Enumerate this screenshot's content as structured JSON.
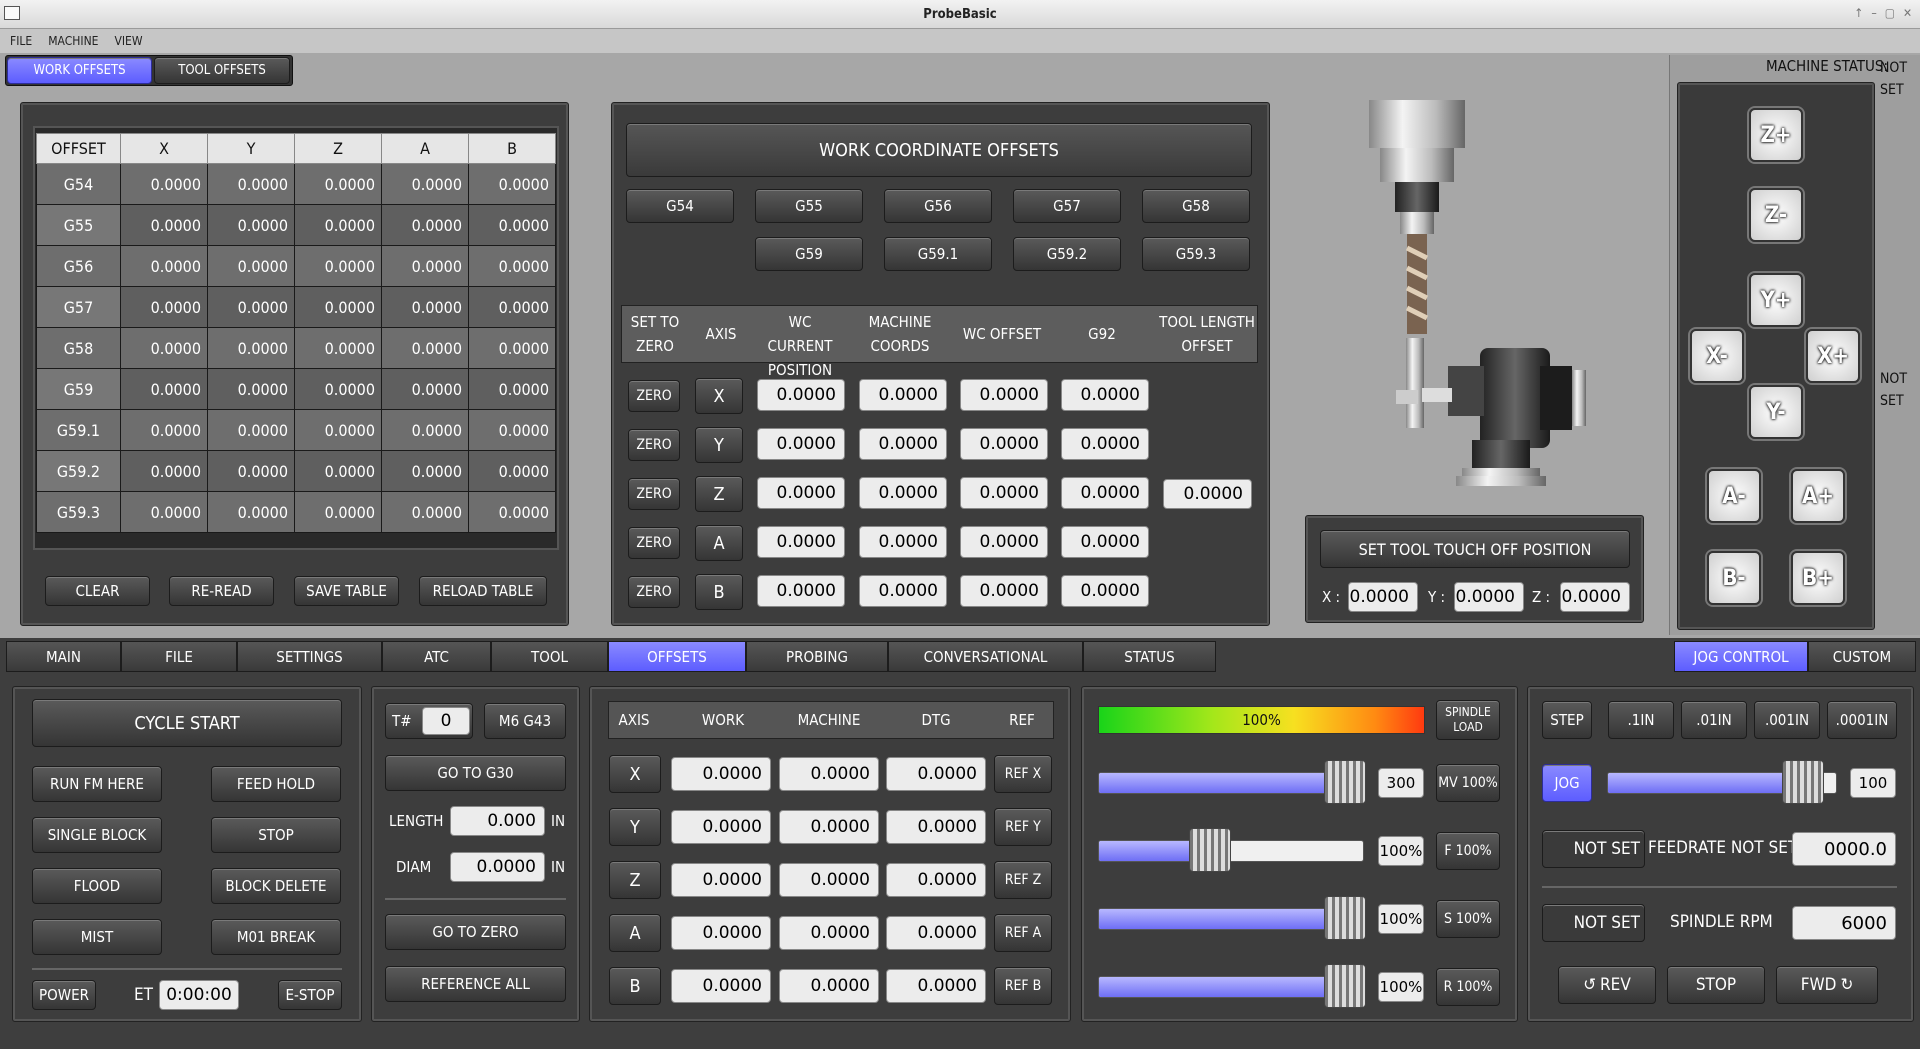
{
  "window": {
    "title": "ProbeBasic"
  },
  "menu": [
    "FILE",
    "MACHINE",
    "VIEW"
  ],
  "top_tabs": {
    "work_offsets": "WORK OFFSETS",
    "tool_offsets": "TOOL OFFSETS"
  },
  "machine_status": {
    "label": "MACHINE STATUS:",
    "value": "NOT SET",
    "side_value": "NOT SET"
  },
  "offsets_table": {
    "headers": [
      "OFFSET",
      "X",
      "Y",
      "Z",
      "A",
      "B"
    ],
    "rows": [
      [
        "G54",
        "0.0000",
        "0.0000",
        "0.0000",
        "0.0000",
        "0.0000"
      ],
      [
        "G55",
        "0.0000",
        "0.0000",
        "0.0000",
        "0.0000",
        "0.0000"
      ],
      [
        "G56",
        "0.0000",
        "0.0000",
        "0.0000",
        "0.0000",
        "0.0000"
      ],
      [
        "G57",
        "0.0000",
        "0.0000",
        "0.0000",
        "0.0000",
        "0.0000"
      ],
      [
        "G58",
        "0.0000",
        "0.0000",
        "0.0000",
        "0.0000",
        "0.0000"
      ],
      [
        "G59",
        "0.0000",
        "0.0000",
        "0.0000",
        "0.0000",
        "0.0000"
      ],
      [
        "G59.1",
        "0.0000",
        "0.0000",
        "0.0000",
        "0.0000",
        "0.0000"
      ],
      [
        "G59.2",
        "0.0000",
        "0.0000",
        "0.0000",
        "0.0000",
        "0.0000"
      ],
      [
        "G59.3",
        "0.0000",
        "0.0000",
        "0.0000",
        "0.0000",
        "0.0000"
      ]
    ],
    "buttons": {
      "clear": "CLEAR",
      "reread": "RE-READ",
      "save": "SAVE TABLE",
      "reload": "RELOAD TABLE"
    }
  },
  "wco": {
    "title": "WORK COORDINATE OFFSETS",
    "row1": [
      "G54",
      "G55",
      "G56",
      "G57",
      "G58"
    ],
    "row2": [
      "G59",
      "G59.1",
      "G59.2",
      "G59.3"
    ],
    "headers": {
      "set_zero": "SET TO ZERO",
      "axis": "AXIS",
      "wc_current": "WC CURRENT POSITION",
      "machine": "MACHINE COORDS",
      "wc_offset": "WC OFFSET",
      "g92": "G92",
      "tool_length": "TOOL LENGTH OFFSET"
    },
    "zero_label": "ZERO",
    "axes": [
      "X",
      "Y",
      "Z",
      "A",
      "B"
    ],
    "value": "0.0000",
    "tool_length_value": "0.0000"
  },
  "touch_off": {
    "button": "SET TOOL TOUCH OFF POSITION",
    "x_label": "X :",
    "y_label": "Y :",
    "z_label": "Z :",
    "x": "0.0000",
    "y": "0.0000",
    "z": "0.0000"
  },
  "jog_buttons": {
    "zp": "Z+",
    "zm": "Z-",
    "yp": "Y+",
    "ym": "Y-",
    "xm": "X-",
    "xp": "X+",
    "am": "A-",
    "ap": "A+",
    "bm": "B-",
    "bp": "B+"
  },
  "main_tabs": [
    "MAIN",
    "FILE",
    "SETTINGS",
    "ATC",
    "TOOL",
    "OFFSETS",
    "PROBING",
    "CONVERSATIONAL",
    "STATUS"
  ],
  "main_tabs_selected": "OFFSETS",
  "right_tabs": {
    "jog_control": "JOG CONTROL",
    "custom": "CUSTOM"
  },
  "program": {
    "cycle_start": "CYCLE START",
    "run_from_here": "RUN FM HERE",
    "feed_hold": "FEED HOLD",
    "single_block": "SINGLE BLOCK",
    "stop": "STOP",
    "flood": "FLOOD",
    "block_delete": "BLOCK DELETE",
    "mist": "MIST",
    "m01_break": "M01 BREAK",
    "power": "POWER",
    "et_label": "ET",
    "et_value": "0:00:00",
    "estop": "E-STOP"
  },
  "tool": {
    "t_label": "T#",
    "t_value": "0",
    "m6": "M6 G43",
    "go_g30": "GO TO G30",
    "length_label": "LENGTH",
    "length_value": "0.000",
    "diam_label": "DIAM",
    "diam_value": "0.0000",
    "unit": "IN",
    "go_zero": "GO TO ZERO",
    "reference_all": "REFERENCE ALL"
  },
  "dro": {
    "headers": [
      "AXIS",
      "WORK",
      "MACHINE",
      "DTG",
      "REF"
    ],
    "rows": [
      {
        "axis": "X",
        "work": "0.0000",
        "machine": "0.0000",
        "dtg": "0.0000",
        "ref": "REF X"
      },
      {
        "axis": "Y",
        "work": "0.0000",
        "machine": "0.0000",
        "dtg": "0.0000",
        "ref": "REF Y"
      },
      {
        "axis": "Z",
        "work": "0.0000",
        "machine": "0.0000",
        "dtg": "0.0000",
        "ref": "REF Z"
      },
      {
        "axis": "A",
        "work": "0.0000",
        "machine": "0.0000",
        "dtg": "0.0000",
        "ref": "REF A"
      },
      {
        "axis": "B",
        "work": "0.0000",
        "machine": "0.0000",
        "dtg": "0.0000",
        "ref": "REF B"
      }
    ]
  },
  "overrides": {
    "spindle_load": {
      "value": "100%",
      "level": 1.0,
      "label": "SPINDLE LOAD"
    },
    "max_velocity": {
      "value": "300",
      "level": 0.93,
      "button": "MV 100%"
    },
    "feed": {
      "value": "100%",
      "level": 0.42,
      "button": "F 100%"
    },
    "spindle": {
      "value": "100%",
      "level": 0.93,
      "button": "S 100%"
    },
    "rapid": {
      "value": "100%",
      "level": 0.93,
      "button": "R 100%"
    }
  },
  "jog_control": {
    "step": "STEP",
    "increments": [
      ".1IN",
      ".01IN",
      ".001IN",
      ".0001IN"
    ],
    "jog": "JOG",
    "jog_value": "100",
    "jog_level": 0.85,
    "feed_status": "NOT SET",
    "feedrate_label": "FEEDRATE NOT SET/",
    "feedrate_value": "0000.0",
    "spindle_status": "NOT SET",
    "spindle_rpm_label": "SPINDLE RPM",
    "spindle_rpm_value": "6000",
    "rev": "REV",
    "stop": "STOP",
    "fwd": "FWD"
  },
  "colors": {
    "accent": "#6b6bff",
    "panel": "#3d3d3d",
    "background": "#a7a7a7"
  }
}
